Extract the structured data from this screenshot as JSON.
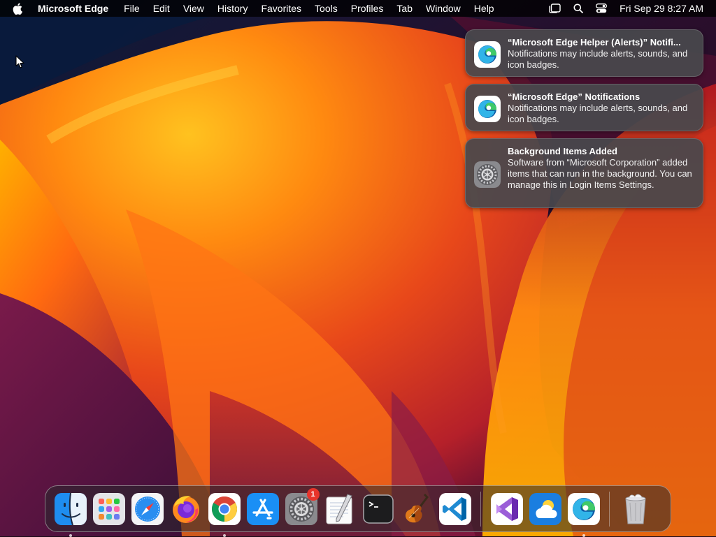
{
  "menubar": {
    "app_name": "Microsoft Edge",
    "menus": [
      "File",
      "Edit",
      "View",
      "History",
      "Favorites",
      "Tools",
      "Profiles",
      "Tab",
      "Window",
      "Help"
    ],
    "clock": "Fri Sep 29  8:27 AM"
  },
  "notifications": [
    {
      "title": "“Microsoft Edge Helper (Alerts)” Notifi...",
      "body": "Notifications may include alerts, sounds, and icon badges.",
      "icon": "edge-icon"
    },
    {
      "title": "“Microsoft Edge” Notifications",
      "body": "Notifications may include alerts, sounds, and icon badges.",
      "icon": "edge-icon"
    },
    {
      "title": "Background Items Added",
      "body": "Software from “Microsoft Corporation” added items that can run in the background. You can manage this in Login Items Settings.",
      "icon": "system-settings-icon"
    }
  ],
  "dock": {
    "apps": [
      "finder",
      "launchpad",
      "safari",
      "firefox",
      "chrome",
      "app-store",
      "system-settings",
      "textedit",
      "terminal",
      "garageband",
      "vscode"
    ],
    "recent_apps": [
      "visual-studio",
      "weather",
      "edge"
    ],
    "system_settings_badge": "1",
    "trash": "trash"
  },
  "colors": {
    "menubar_bg": "#000000",
    "notification_bg": "#48484c",
    "badge": "#e8342b",
    "edge_blue": "#0c59a4",
    "edge_green": "#40c969"
  }
}
